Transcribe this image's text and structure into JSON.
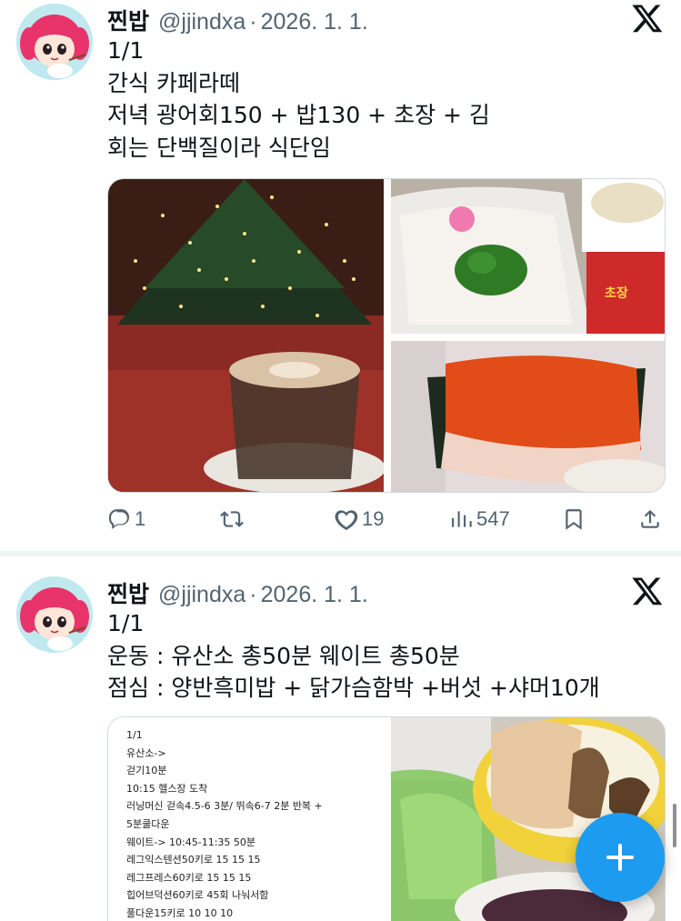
{
  "tweets": [
    {
      "name": "찐밥",
      "handle": "@jjindxa",
      "separator": "·",
      "date": "2026. 1. 1.",
      "lines": [
        "1/1",
        "간식 카페라떼",
        "저녁 광어회150 + 밥130 + 초장 + 김",
        "회는 단백질이라 식단임"
      ],
      "photos": [
        "christmas-tree-latte",
        "flounder-sashimi-parsley",
        "sashimi-rice-seaweed"
      ],
      "actions": {
        "reply": {
          "icon": "reply-icon",
          "count": "1"
        },
        "retweet": {
          "icon": "retweet-icon",
          "count": ""
        },
        "like": {
          "icon": "heart-icon",
          "count": "19"
        },
        "views": {
          "icon": "views-icon",
          "count": "547"
        },
        "bookmark": {
          "icon": "bookmark-icon"
        },
        "share": {
          "icon": "share-icon"
        }
      }
    },
    {
      "name": "찐밥",
      "handle": "@jjindxa",
      "separator": "·",
      "date": "2026. 1. 1.",
      "lines": [
        "1/1",
        "운동 : 유산소 총50분 웨이트 총50분",
        "점심 : 양반흑미밥 + 닭가슴함박 +버섯 +샤머10개"
      ],
      "note_lines": [
        "1/1",
        "유산소->",
        "걷기10분",
        "10:15 헬스장 도착",
        "러닝머신 걷속4.5-6 3분/ 뛰속6-7 2분 반복 +",
        "5분쿨다운",
        "웨이트-> 10:45-11:35 50분",
        "레그익스텐션50키로 15 15 15",
        "레그프레스60키로 15 15 15",
        "힙어브덕션60키로 45회 나눠서함",
        "풀다운15키로 10 10 10"
      ]
    }
  ],
  "fab": {
    "icon": "plus-icon",
    "label": "+"
  },
  "colors": {
    "accent": "#1d9bf0",
    "secondary_text": "#536471",
    "divider": "#eff3f4"
  }
}
